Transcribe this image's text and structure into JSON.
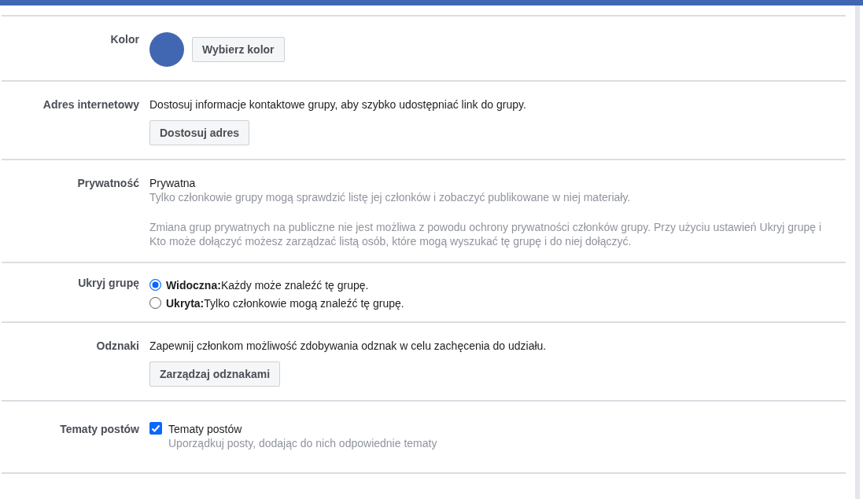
{
  "sections": [
    {
      "kind": "color",
      "label": "Kolor",
      "color": "#4267b2",
      "button": "Wybierz kolor"
    },
    {
      "kind": "address",
      "label": "Adres internetowy",
      "description": "Dostosuj informacje kontaktowe grupy, aby szybko udostępniać link do grupy.",
      "button": "Dostosuj adres"
    },
    {
      "kind": "privacy",
      "label": "Prywatność",
      "value": "Prywatna",
      "notes": [
        "Tylko członkowie grupy mogą sprawdzić listę jej członków i zobaczyć publikowane w niej materiały.",
        "Zmiana grup prywatnych na publiczne nie jest możliwa z powodu ochrony prywatności członków grupy. Przy użyciu ustawień Ukryj grupę i Kto może dołączyć możesz zarządzać listą osób, które mogą wyszukać tę grupę i do niej dołączyć."
      ]
    },
    {
      "kind": "radios",
      "label": "Ukryj grupę",
      "options": [
        {
          "text": "**Widoczna:**Każdy może znaleźć tę grupę.",
          "selected": true
        },
        {
          "text": "**Ukryta:**Tylko członkowie mogą znaleźć tę grupę.",
          "selected": false
        }
      ]
    },
    {
      "kind": "address",
      "label": "Odznaki",
      "description": "Zapewnij członkom możliwość zdobywania odznak w celu zachęcenia do udziału.",
      "button": "Zarządzaj odznakami"
    },
    {
      "kind": "checkbox",
      "label": "Tematy postów",
      "checked": true,
      "title": "Tematy postów",
      "hint": "Uporządkuj posty, dodając do nich odpowiednie tematy"
    }
  ]
}
